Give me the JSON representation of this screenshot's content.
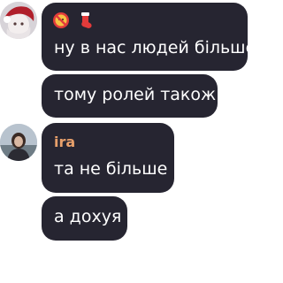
{
  "messages": [
    {
      "text": "ну в нас людей більше",
      "emojis": [
        "no-entry-face-icon",
        "stocking-icon"
      ]
    },
    {
      "text": "тому ролей також"
    },
    {
      "author": "ira",
      "author_color": "#e8a06b",
      "text": "та не більше"
    },
    {
      "text": "а дохуя"
    }
  ],
  "colors": {
    "bubble": "#262531",
    "text": "#ffffff",
    "background": "#ffffff"
  }
}
